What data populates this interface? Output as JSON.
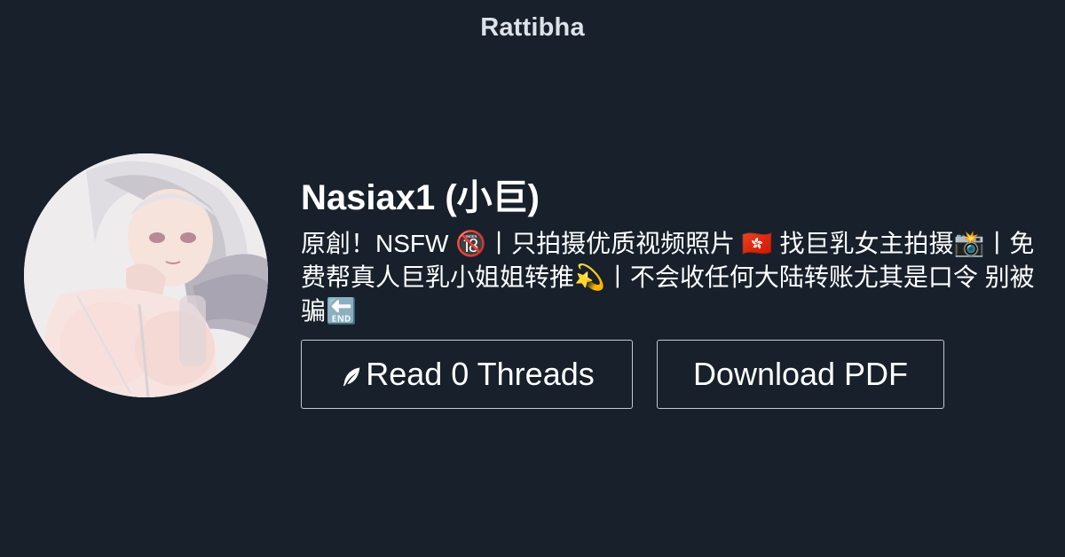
{
  "site": {
    "brand": "Rattibha"
  },
  "profile": {
    "name": "Nasiax1 (小巨)",
    "bio": "原創！NSFW 🔞丨只拍摄优质视频照片 🇭🇰 找巨乳女主拍摄📸丨免费帮真人巨乳小姐姐转推💫丨不会收任何大陆转账尤其是口令 别被骗🔚"
  },
  "actions": {
    "read_label": "Read 0 Threads",
    "read_icon": "feather-icon",
    "pdf_label": "Download PDF"
  },
  "colors": {
    "background": "#17202b",
    "text": "#ffffff",
    "brand_text": "#dde2e8",
    "button_border": "#c3c9d0"
  }
}
